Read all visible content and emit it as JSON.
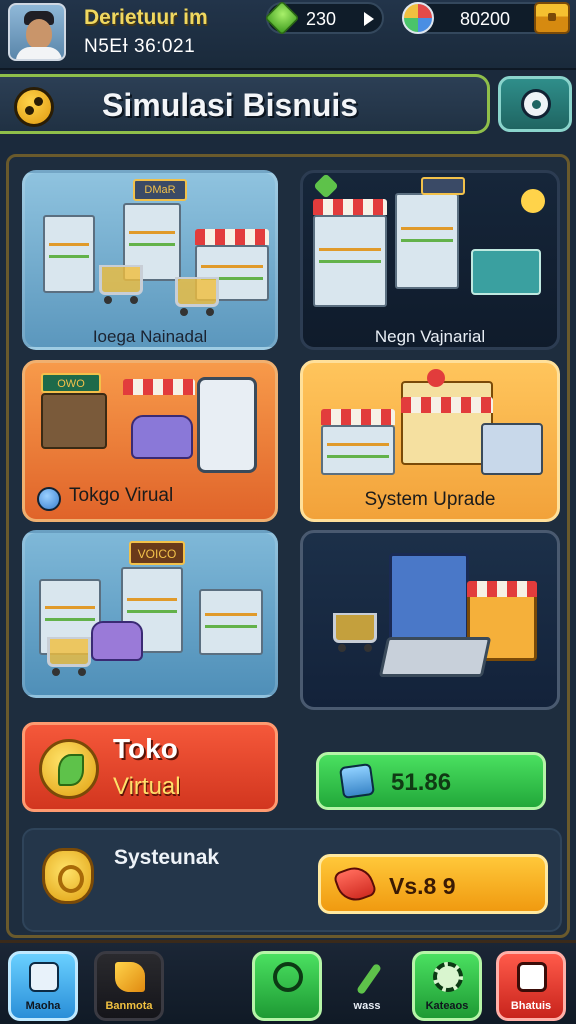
{
  "player": {
    "name": "Derietuur im",
    "time": "N5EƗ 36:021"
  },
  "currency": {
    "gems": "230",
    "coins": "80200"
  },
  "header": {
    "title": "Simulasi Bisnuis"
  },
  "cards": [
    {
      "label": "Ioega Nainadal"
    },
    {
      "label": "Negn Vajnarial"
    },
    {
      "label": "Tokgo Virual"
    },
    {
      "label": "System Uprade"
    },
    {
      "label": ""
    },
    {
      "label": ""
    }
  ],
  "scene_signs": {
    "c1": "DMaR",
    "c3": "OWO",
    "c5": "VOICO"
  },
  "toko": {
    "title": "Toko",
    "subtitle": "Virtual"
  },
  "green_button": {
    "value": "51.86"
  },
  "system_row": {
    "title": "Systeunak",
    "button_value": "Vs.8 9"
  },
  "bottom_nav": [
    {
      "label": "Maoha",
      "icon": "monitor-icon"
    },
    {
      "label": "Banmota",
      "icon": "cheese-icon"
    },
    {
      "label": "",
      "icon": "recycle-icon"
    },
    {
      "label": "wass",
      "icon": "pencil-icon"
    },
    {
      "label": "Kateaos",
      "icon": "gear-icon"
    },
    {
      "label": "Bhatuis",
      "icon": "camera-icon"
    }
  ],
  "colors": {
    "accent_green": "#4ae060",
    "accent_orange": "#f09a10",
    "accent_red": "#d2361f",
    "panel": "#1e2d3e"
  }
}
